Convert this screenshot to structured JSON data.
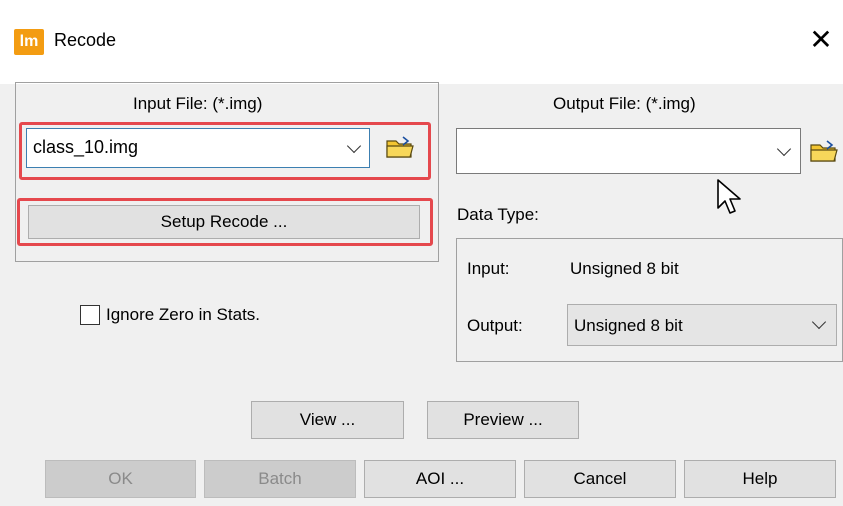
{
  "window": {
    "app_icon_text": "lm",
    "title": "Recode",
    "close_glyph": "✕"
  },
  "input": {
    "label": "Input File: (*.img)",
    "value": "class_10.img",
    "setup_button": "Setup Recode ..."
  },
  "output": {
    "label": "Output File: (*.img)",
    "value": ""
  },
  "options": {
    "ignore_zero_label": "Ignore Zero in Stats.",
    "ignore_zero_checked": false
  },
  "data_type": {
    "label": "Data Type:",
    "input_label": "Input:",
    "input_value": "Unsigned 8 bit",
    "output_label": "Output:",
    "output_value": "Unsigned 8 bit"
  },
  "buttons": {
    "view": "View ...",
    "preview": "Preview ...",
    "ok": "OK",
    "batch": "Batch",
    "aoi": "AOI ...",
    "cancel": "Cancel",
    "help": "Help"
  },
  "colors": {
    "highlight": "#e5484d",
    "app_icon": "#f39c12",
    "folder": "#f3c531"
  }
}
